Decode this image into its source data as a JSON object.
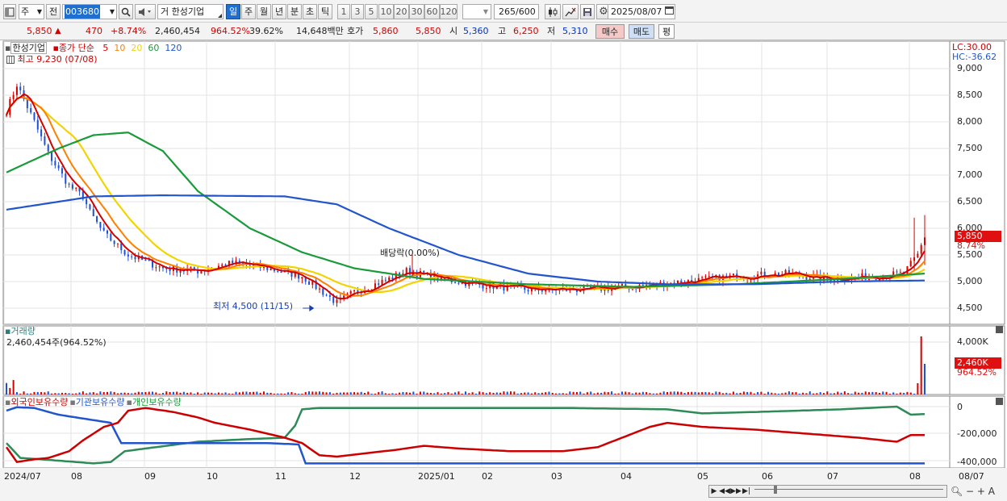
{
  "toolbar": {
    "market": "주",
    "prev_label": "전",
    "code": "003680",
    "name": "거 한성기업",
    "periods": [
      "일",
      "주",
      "월",
      "년",
      "분",
      "초",
      "틱"
    ],
    "active_period": "일",
    "intervals": [
      "1",
      "3",
      "5",
      "10",
      "20",
      "30",
      "60",
      "120"
    ],
    "count": "265",
    "count_max": "/600",
    "date": "2025/08/07"
  },
  "quote": {
    "price": "5,850",
    "arrow": "▲",
    "change": "470",
    "change_pct": "+8.74%",
    "volume": "2,460,454",
    "volume_pct": "964.52%",
    "turnover_pct": "39.62%",
    "amount": "14,648백만",
    "hoga_label": "호가",
    "ask": "5,860",
    "bid": "5,850",
    "open_label": "시",
    "open": "5,360",
    "high_label": "고",
    "high": "6,250",
    "low_label": "저",
    "low": "5,310",
    "buy": "매수",
    "sell": "매도",
    "eval": "평"
  },
  "price_pane": {
    "legend_name": "한성기업",
    "legend_ma_label": "종가 단순",
    "legend_ma": [
      {
        "p": "5",
        "color": "#d40000"
      },
      {
        "p": "10",
        "color": "#ff7f00"
      },
      {
        "p": "20",
        "color": "#f2d400"
      },
      {
        "p": "60",
        "color": "#1a9a3a"
      },
      {
        "p": "120",
        "color": "#2255cc"
      }
    ],
    "high_note": "최고 9,230 (07/08)",
    "low_note": "최저 4,500 (11/15)",
    "dividend_note": "배당락(0.00%)",
    "lc": "LC:30.00",
    "hc": "HC:-36.62",
    "y_ticks": [
      "9,000",
      "8,500",
      "8,000",
      "7,500",
      "7,000",
      "6,500",
      "6,000",
      "5,500",
      "5,000",
      "4,500"
    ],
    "last_price": "5,850",
    "last_pct": "8.74%"
  },
  "volume_pane": {
    "title": "거래량",
    "value": "2,460,454주(964.52%)",
    "y_tick": "4,000K",
    "last": "2,460K",
    "last_pct": "964.52%"
  },
  "holding_pane": {
    "legend": [
      {
        "label": "외국인보유수량",
        "color": "#cc0000"
      },
      {
        "label": "기관보유수량",
        "color": "#2255cc"
      },
      {
        "label": "개인보유수량",
        "color": "#1a9a3a"
      }
    ],
    "y_ticks": [
      "0",
      "-200,000",
      "-400,000"
    ]
  },
  "x_axis": [
    "2024/07",
    "08",
    "09",
    "10",
    "11",
    "12",
    "2025/01",
    "02",
    "03",
    "04",
    "05",
    "06",
    "07",
    "08"
  ],
  "x_axis_right": "08/07",
  "colors": {
    "up": "#d60000",
    "down": "#0033cc",
    "accent": "#1f6fd1"
  }
}
